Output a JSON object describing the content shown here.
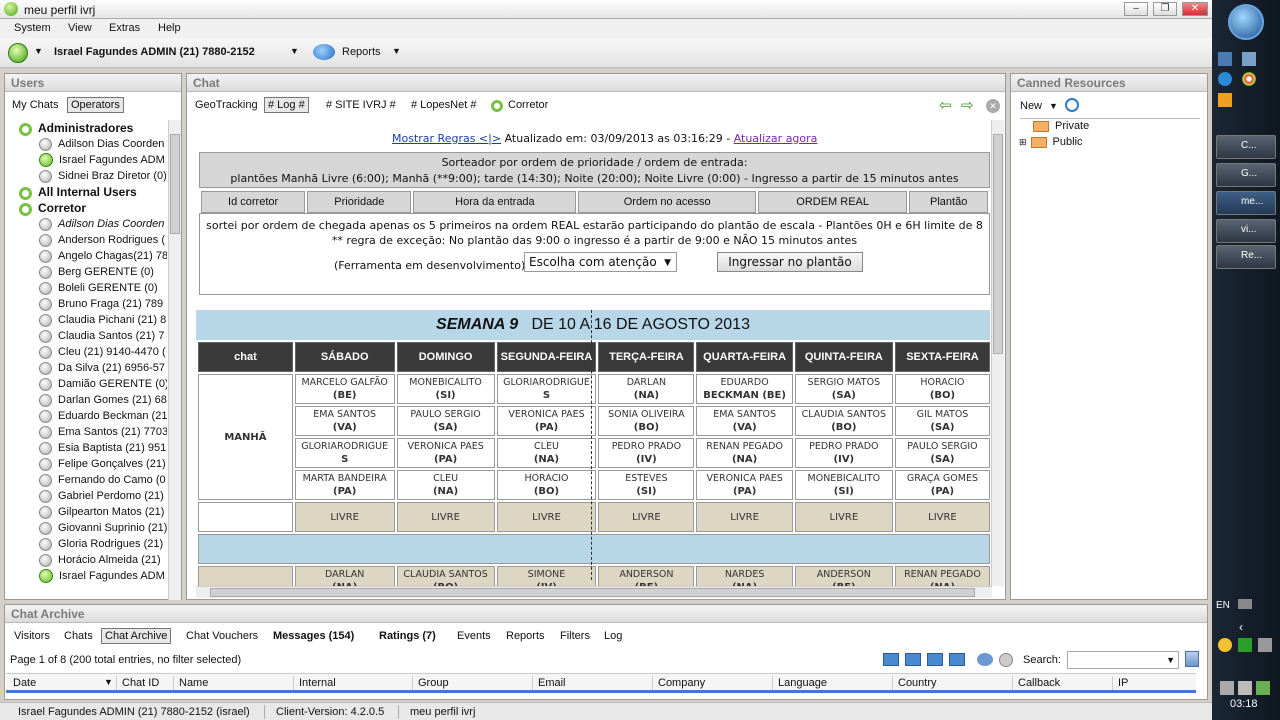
{
  "window": {
    "title": "meu perfil ivrj"
  },
  "menu": [
    "System",
    "View",
    "Extras",
    "Help"
  ],
  "toolbar": {
    "user": "Israel Fagundes ADMIN  (21) 7880-2152",
    "reports": "Reports"
  },
  "users": {
    "title": "Users",
    "tabs": [
      "My Chats",
      "Operators"
    ],
    "groups": {
      "admins": "Administradores",
      "internal": "All Internal Users",
      "corretor": "Corretor"
    },
    "admins": [
      "Adilson Dias Coorden",
      "Israel Fagundes ADM",
      "Sidnei Braz Diretor (0)"
    ],
    "corretores": [
      "Adilson Dias Coorden",
      "Anderson Rodrigues (",
      "Angelo Chagas(21) 78",
      "Berg GERENTE (0)",
      "Boleli GERENTE (0)",
      "Bruno Fraga (21) 789",
      "Claudia Pichani (21) 8",
      "Claudia Santos (21) 7",
      "Cleu (21) 9140-4470 (",
      "Da Silva (21) 6956-57",
      "Damião GERENTE (0)",
      "Darlan Gomes (21) 68",
      "Eduardo Beckman (21",
      "Ema Santos (21) 7703",
      "Esia Baptista (21) 951",
      "Felipe Gonçalves (21)",
      "Fernando do Camo (0",
      "Gabriel Perdomo (21)",
      "Gilpearton Matos (21)",
      "Giovanni Suprinio (21)",
      "Gloria Rodrigues (21)",
      "Horácio Almeida (21)",
      "Israel Fagundes ADM"
    ]
  },
  "chat": {
    "title": "Chat",
    "tabs": [
      "GeoTracking",
      "# Log #",
      "# SITE IVRJ #",
      "# LopesNet #",
      "Corretor"
    ],
    "rules_link": "Mostrar Regras <|>",
    "updated": "Atualizado em: 03/09/2013 as 03:16:29 - ",
    "update_now": "Atualizar agora",
    "sort_line1": "Sorteador por ordem de prioridade / ordem de entrada:",
    "sort_line2": "plantões Manhã Livre (6:00); Manhã (**9:00); tarde (14:30); Noite (20:00); Noite Livre (0:00) - Ingresso a partir de 15 minutos antes",
    "columns": [
      "Id corretor",
      "Prioridade",
      "Hora da entrada",
      "Ordem no acesso",
      "ORDEM REAL",
      "Plantão"
    ],
    "note1": "sortei por ordem de chegada apenas os 5 primeiros na ordem REAL estarão participando do plantão de escala - Plantões 0H e 6H limite de 8",
    "note2": "** regra de exceção: No plantão das 9:00 o ingresso é a partir de 9:00 e NÃO 15 minutos antes",
    "tool_label": "(Ferramenta em desenvolvimento)",
    "select_value": "Escolha com atenção",
    "join_button": "Ingressar no plantão",
    "week_bold": "SEMANA 9",
    "week_range": "DE 10 A 16 DE AGOSTO 2013",
    "days": [
      "chat",
      "SÁBADO",
      "DOMINGO",
      "SEGUNDA-FEIRA",
      "TERÇA-FEIRA",
      "QUARTA-FEIRA",
      "QUINTA-FEIRA",
      "SEXTA-FEIRA"
    ],
    "shift": "MANHÃ",
    "rows": [
      [
        "MARCELO GALFÃO|(BE)",
        "MONEBICALITO|(SI)",
        "GLORIARODRIGUE|S",
        "DARLAN|(NA)",
        "EDUARDO|BECKMAN (BE)",
        "SERGIO MATOS|(SA)",
        "HORACIO|(BO)"
      ],
      [
        "EMA SANTOS|(VA)",
        "PAULO SERGIO|(SA)",
        "VERONICA PAES|(PA)",
        "SONIA OLIVEIRA|(BO)",
        "EMA SANTOS|(VA)",
        "CLAUDIA SANTOS|(BO)",
        "GIL MATOS|(SA)"
      ],
      [
        "GLORIARODRIGUE|S",
        "VERONICA PAES|(PA)",
        "CLEU|(NA)",
        "PEDRO PRADO|(IV)",
        "RENAN PEGADO|(NA)",
        "PEDRO PRADO|(IV)",
        "PAULO SERGIO|(SA)"
      ],
      [
        "MARTA BANDEIRA|(PA)",
        "CLEU|(NA)",
        "HORACIO|(BO)",
        "ESTEVES|(SI)",
        "VERONICA PAES|(PA)",
        "MONEBICALITO|(SI)",
        "GRAÇA GOMES|(PA)"
      ]
    ],
    "livre": "LIVRE",
    "rows2": [
      [
        "DARLAN|(NA)",
        "CLAUDIA SANTOS|(BO)",
        "SIMONE|(IV)",
        "ANDERSON|(BE)",
        "NARDES|(NA)",
        "ANDERSON|(BE)",
        "RENAN PEGADO|(NA)"
      ]
    ]
  },
  "canned": {
    "title": "Canned Resources",
    "new": "New",
    "items": [
      "Private",
      "Public"
    ]
  },
  "archive": {
    "title": "Chat Archive",
    "tabs": [
      "Visitors",
      "Chats",
      "Chat Archive",
      "Chat Vouchers",
      "Messages (154)",
      "Ratings (7)",
      "Events",
      "Reports",
      "Filters",
      "Log"
    ],
    "page_info": "Page 1 of 8 (200 total entries, no filter selected)",
    "search_label": "Search:",
    "columns": [
      "Date",
      "Chat ID",
      "Name",
      "Internal",
      "Group",
      "Email",
      "Company",
      "Language",
      "Country",
      "Callback",
      "IP"
    ]
  },
  "status": [
    "Israel Fagundes ADMIN  (21) 7880-2152 (israel)",
    "Client-Version: 4.2.0.5",
    "meu perfil ivrj"
  ],
  "taskbar": {
    "items": [
      "C...",
      "G...",
      "me...",
      "vi...",
      "Re..."
    ],
    "lang": "EN",
    "time": "03:18"
  }
}
